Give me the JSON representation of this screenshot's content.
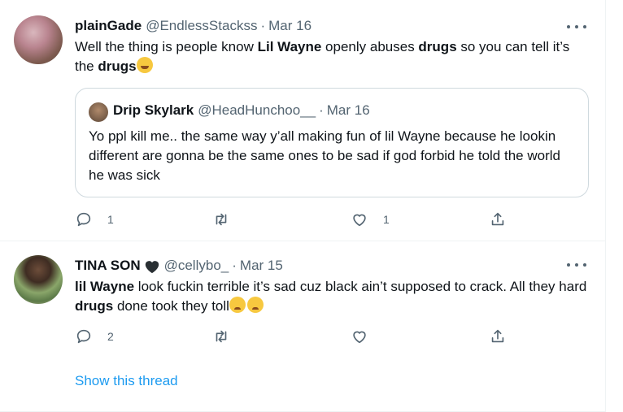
{
  "tweets": [
    {
      "name": "plainGade",
      "handle": "@EndlessStackss",
      "date": "Mar 16",
      "text_parts": [
        "Well the thing is people know ",
        "Lil Wayne",
        " openly abuses ",
        "drugs",
        " so you can tell it’s the ",
        "drugs"
      ],
      "emoji_icon": "grinning-sweat-emoji",
      "quote": {
        "name": "Drip Skylark",
        "handle": "@HeadHunchoo__",
        "date": "Mar 16",
        "text": "Yo ppl kill me.. the same way y’all making fun of lil Wayne because he lookin different are gonna be the same ones to be sad if god forbid he told the world he was sick"
      },
      "actions": {
        "replies": "1",
        "retweets": "",
        "likes": "1"
      }
    },
    {
      "name": "TINA SON",
      "name_icon": "black-heart-icon",
      "handle": "@cellybo_",
      "date": "Mar 15",
      "text_parts": [
        "lil Wayne",
        " look fuckin terrible it’s sad cuz black ain’t supposed to crack. All they hard ",
        "drugs",
        " done took they toll"
      ],
      "emoji_icon": "pleading-face-emoji",
      "actions": {
        "replies": "2",
        "retweets": "",
        "likes": ""
      },
      "show_thread": "Show this thread"
    }
  ],
  "colors": {
    "accent": "#1d9bf0",
    "secondary_text": "#536471",
    "border": "#cfd9de"
  }
}
